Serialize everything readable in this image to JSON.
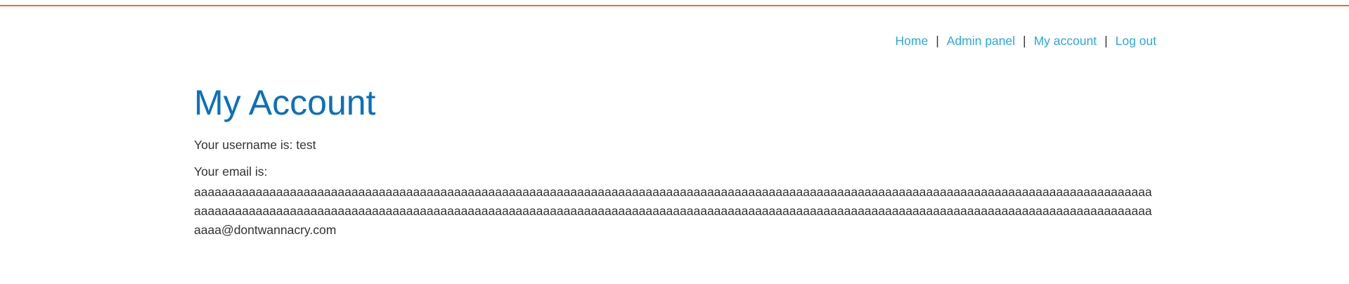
{
  "nav": {
    "home": "Home",
    "admin_panel": "Admin panel",
    "my_account": "My account",
    "log_out": "Log out",
    "separator": "|"
  },
  "main": {
    "title": "My Account",
    "username_line": "Your username is: test",
    "email_label": "Your email is:",
    "email_value": "aaaaaaaaaaaaaaaaaaaaaaaaaaaaaaaaaaaaaaaaaaaaaaaaaaaaaaaaaaaaaaaaaaaaaaaaaaaaaaaaaaaaaaaaaaaaaaaaaaaaaaaaaaaaaaaaaaaaaaaaaaaaaaaaaaaaaaaaaaaaaaaaaaaaaaaaaaaaaaaaaaaaaaaaaaaaaaaaaaaaaaaaaaaaaaaaaaaaaaaaaaaaaaaaaaaaaaaaaaaaaaaaaaaaaaaaaaaaaaaaaaaaaaaaaaaaaaaaaaaaaaaaaaaaaaaaaaaaaaaaaaaa@dontwannacry.com"
  },
  "colors": {
    "accent_rule": "#ec6933",
    "link": "#29a9e0",
    "title": "#0a71ba",
    "text": "#333333"
  }
}
